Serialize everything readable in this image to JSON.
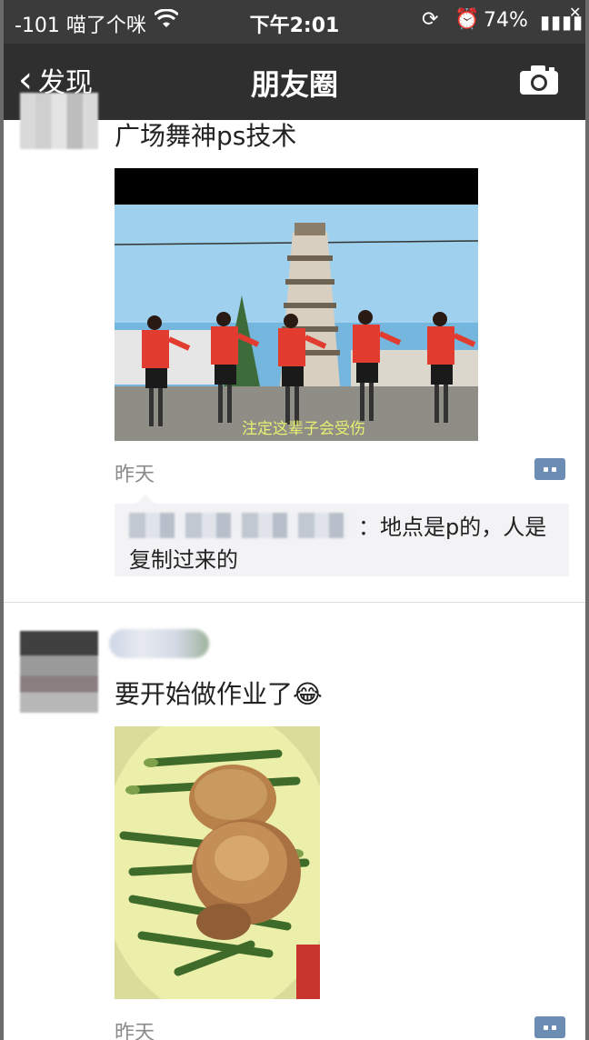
{
  "status_bar": {
    "carrier": "-101 喵了个咪",
    "time": "下午2:01",
    "battery": "74%"
  },
  "nav": {
    "back_label": "发现",
    "title": "朋友圈"
  },
  "posts": [
    {
      "text": "广场舞神ps技术",
      "image_caption": "注定这辈子会受伤",
      "time": "昨天",
      "comment_text": "：地点是p的，人是复制过来的"
    },
    {
      "text": "要开始做作业了😂",
      "time": "昨天"
    }
  ],
  "colors": {
    "navbar": "#2f2f2f",
    "statusbar": "#3b3b3b",
    "action_button": "#6d8cb4",
    "comment_bg": "#f3f3f5"
  },
  "icons": [
    "wifi-icon",
    "orientation-lock-icon",
    "alarm-icon",
    "signal-icon",
    "back-chevron-icon",
    "camera-icon",
    "comment-action-icon"
  ]
}
